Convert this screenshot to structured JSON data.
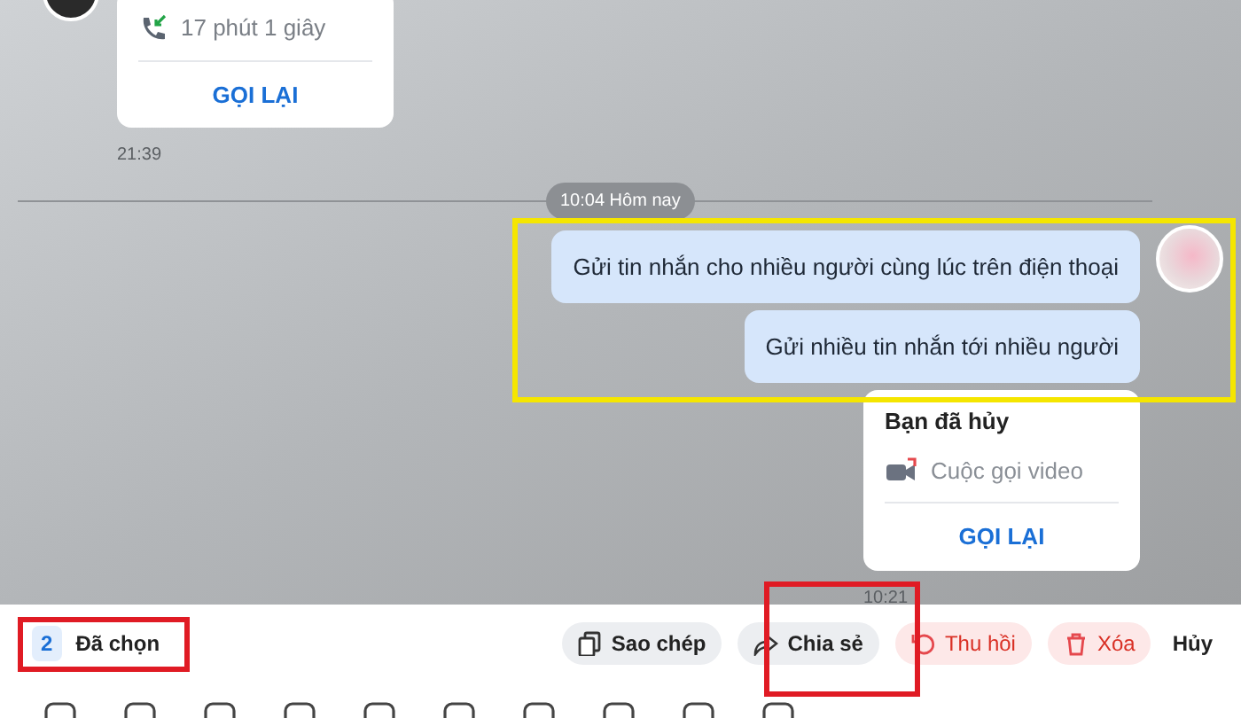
{
  "messages": [
    {
      "kind": "call",
      "from_me": false,
      "duration": "17 phút 1 giây",
      "action": "GỌI LẠI",
      "time": "21:39"
    },
    {
      "kind": "divider",
      "label": "10:04 Hôm nay"
    },
    {
      "kind": "text",
      "from_me": true,
      "text": "Gửi tin nhắn cho nhiều người cùng lúc trên điện thoại"
    },
    {
      "kind": "text",
      "from_me": true,
      "text": "Gửi nhiều tin nhắn tới nhiều người"
    },
    {
      "kind": "videocall",
      "from_me": true,
      "title": "Bạn đã hủy",
      "label": "Cuộc gọi video",
      "action": "GỌI LẠI",
      "time": "10:21"
    }
  ],
  "selection_bar": {
    "count": "2",
    "label": "Đã chọn",
    "actions": [
      {
        "kind": "copy",
        "label": "Sao chép",
        "danger": false
      },
      {
        "kind": "share",
        "label": "Chia sẻ",
        "danger": false
      },
      {
        "kind": "recall",
        "label": "Thu hồi",
        "danger": true
      },
      {
        "kind": "delete",
        "label": "Xóa",
        "danger": true
      },
      {
        "kind": "cancel",
        "label": "Hủy",
        "danger": false
      }
    ]
  },
  "annotations": [
    {
      "color": "#f5e600"
    },
    {
      "color": "#e01b24"
    },
    {
      "color": "#e01b24"
    }
  ]
}
